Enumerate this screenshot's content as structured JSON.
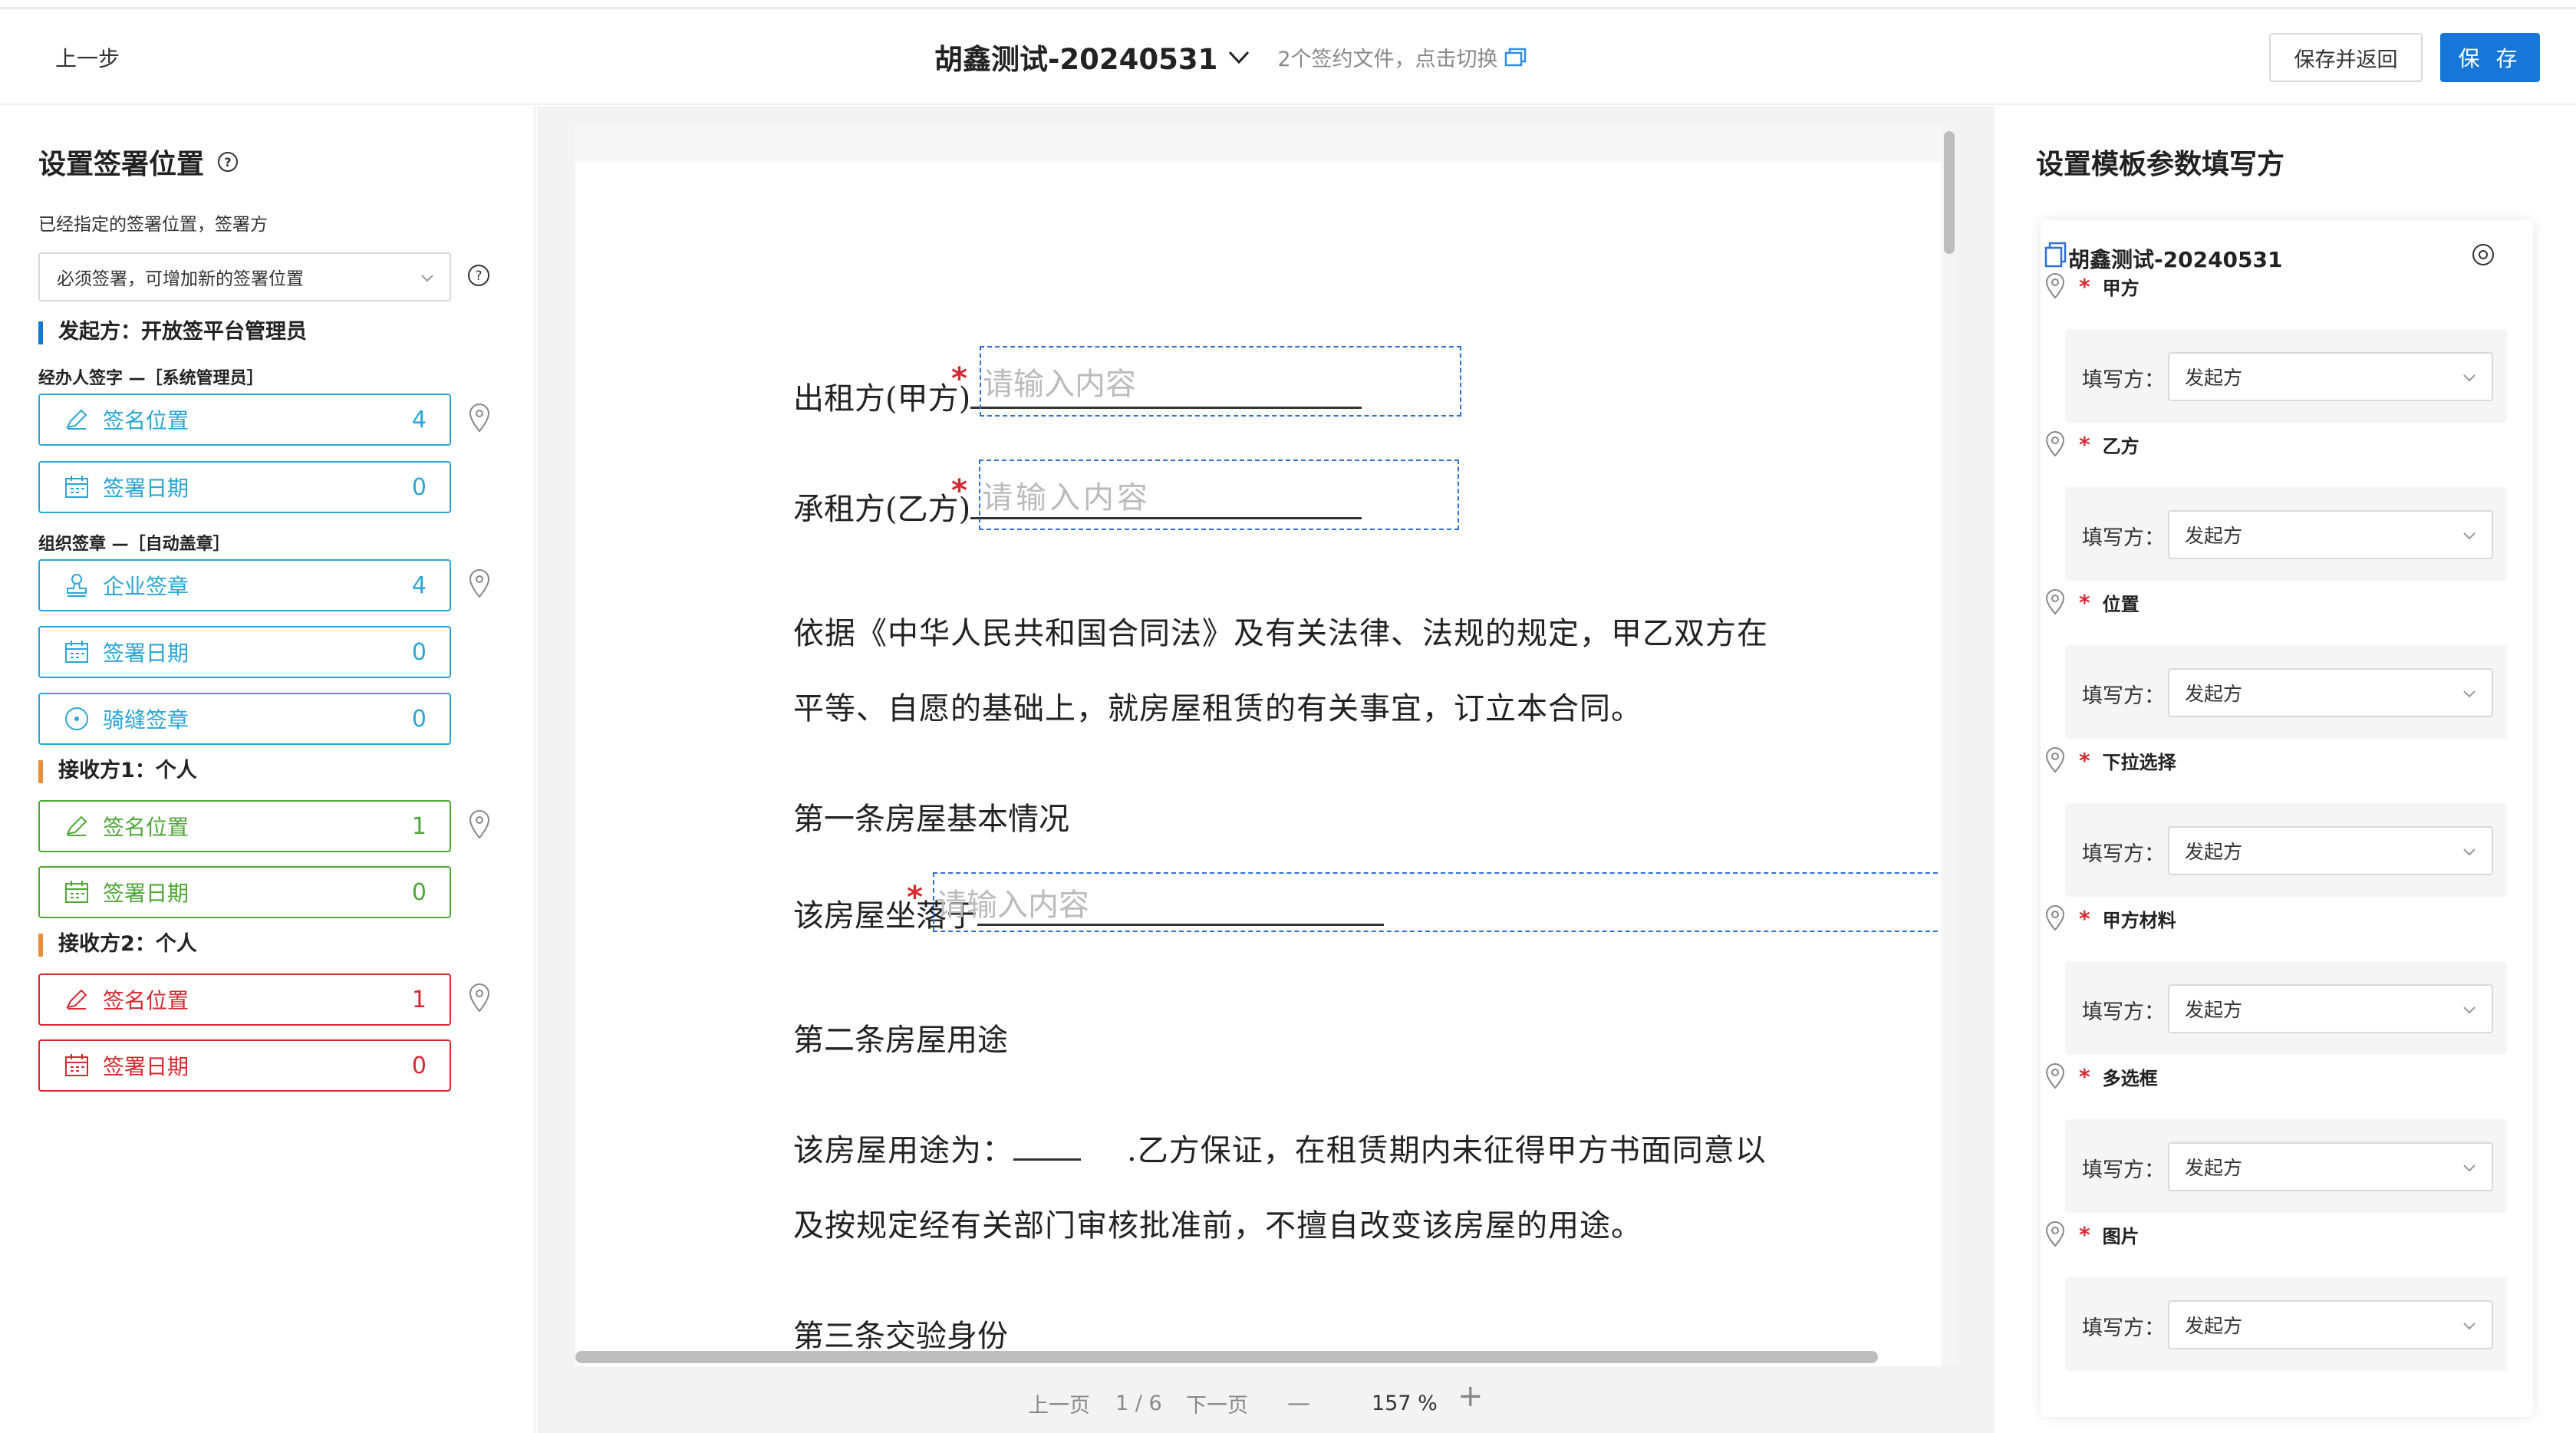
{
  "header": {
    "prev_label": "上一步",
    "doc_title": "胡鑫测试-20240531",
    "switch_hint": "2个签约文件，点击切换",
    "save_return_label": "保存并返回",
    "save_label": "保 存"
  },
  "left": {
    "title": "设置签署位置",
    "assigned_label": "已经指定的签署位置，签署方",
    "mode_select": "必须签署，可增加新的签署位置",
    "parties": [
      {
        "head": "发起方：开放签平台管理员",
        "groups": [
          {
            "sub": "经办人签字 —［系统管理员］",
            "items": [
              {
                "label": "签名位置",
                "count": "4",
                "icon": "pen-icon"
              },
              {
                "label": "签署日期",
                "count": "0",
                "icon": "calendar-icon"
              }
            ]
          },
          {
            "sub": "组织签章 —［自动盖章］",
            "items": [
              {
                "label": "企业签章",
                "count": "4",
                "icon": "stamp-icon"
              },
              {
                "label": "签署日期",
                "count": "0",
                "icon": "calendar-icon"
              },
              {
                "label": "骑缝签章",
                "count": "0",
                "icon": "seal-icon"
              }
            ]
          }
        ]
      },
      {
        "head": "接收方1：个人",
        "items": [
          {
            "label": "签名位置",
            "count": "1",
            "icon": "pen-icon"
          },
          {
            "label": "签署日期",
            "count": "0",
            "icon": "calendar-icon"
          }
        ]
      },
      {
        "head": "接收方2：个人",
        "items": [
          {
            "label": "签名位置",
            "count": "1",
            "icon": "pen-icon"
          },
          {
            "label": "签署日期",
            "count": "0",
            "icon": "calendar-icon"
          }
        ]
      }
    ]
  },
  "doc": {
    "lessor": "出租方(甲方)",
    "lessee": "承租方(乙方)",
    "para1": "依据《中华人民共和国合同法》及有关法律、法规的规定，甲乙双方在",
    "para2": "平等、自愿的基础上，就房屋租赁的有关事宜，订立本合同。",
    "art1": "第一条房屋基本情况",
    "location": "该房屋坐落于",
    "art2": "第二条房屋用途",
    "use1a": "该房屋用途为：",
    "use1b": ".乙方保证，在租赁期内未征得甲方书面同意以",
    "use2": "及按规定经有关部门审核批准前，不擅自改变该房屋的用途。",
    "art3": "第三条交验身份",
    "placeholder": "请输入内容",
    "required_mark": "*"
  },
  "pager": {
    "prev": "上一页",
    "page": "1 / 6",
    "next": "下一页",
    "zoom_minus": "—",
    "zoom": "157 %",
    "zoom_plus": "+"
  },
  "right": {
    "title": "设置模板参数填写方",
    "card_title": "胡鑫测试-20240531",
    "filler_label": "填写方：",
    "required_mark": "*",
    "params": [
      {
        "name": "甲方",
        "filler": "发起方"
      },
      {
        "name": "乙方",
        "filler": "发起方"
      },
      {
        "name": "位置",
        "filler": "发起方"
      },
      {
        "name": "下拉选择",
        "filler": "发起方"
      },
      {
        "name": "甲方材料",
        "filler": "发起方"
      },
      {
        "name": "多选框",
        "filler": "发起方"
      },
      {
        "name": "图片",
        "filler": "发起方"
      }
    ]
  },
  "colors": {
    "primary": "#1677d8",
    "initiator": "#2aa6d6",
    "receiver1": "#4ea836",
    "receiver2": "#d9282f",
    "required": "#d9282f"
  }
}
